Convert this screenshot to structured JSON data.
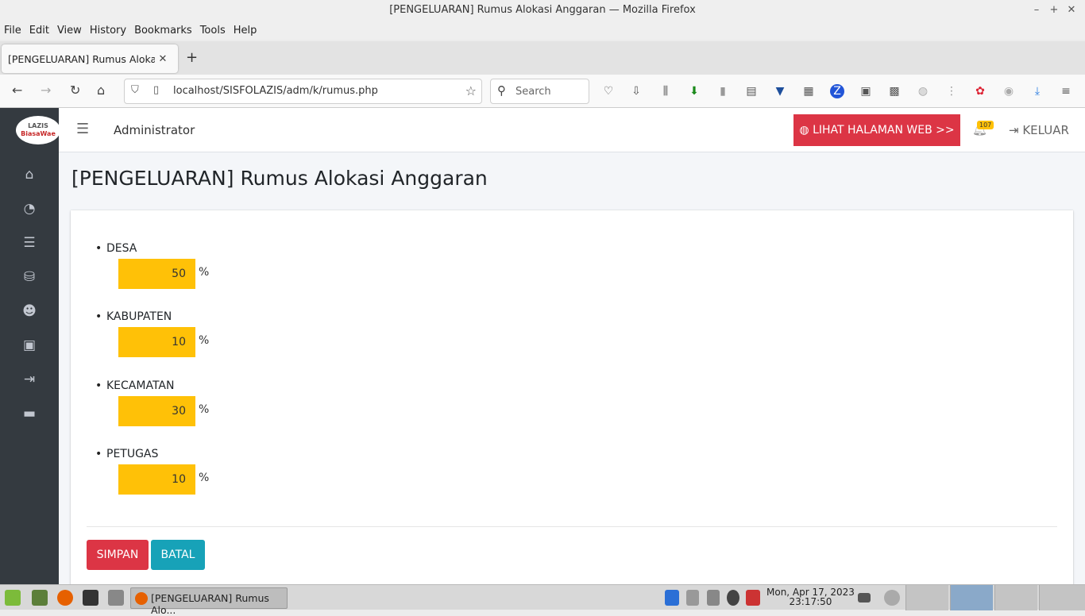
{
  "window": {
    "title": "[PENGELUARAN] Rumus Alokasi Anggaran — Mozilla Firefox"
  },
  "menu": [
    "File",
    "Edit",
    "View",
    "History",
    "Bookmarks",
    "Tools",
    "Help"
  ],
  "tab": {
    "title": "[PENGELUARAN] Rumus Alokasi A"
  },
  "nav": {
    "url": "localhost/SISFOLAZIS/adm/k/rumus.php",
    "search_placeholder": "Search"
  },
  "app": {
    "logo_line1": "LAZIS",
    "logo_line2": "BiasaWae",
    "user": "Administrator",
    "web_button": "LIHAT HALAMAN WEB >>",
    "notif_count": "107",
    "logout": "KELUAR",
    "page_title": "[PENGELUARAN] Rumus Alokasi Anggaran",
    "allocations": [
      {
        "label": "DESA",
        "value": "50",
        "unit": "%"
      },
      {
        "label": "KABUPATEN",
        "value": "10",
        "unit": "%"
      },
      {
        "label": "KECAMATAN",
        "value": "30",
        "unit": "%"
      },
      {
        "label": "PETUGAS",
        "value": "10",
        "unit": "%"
      }
    ],
    "save": "SIMPAN",
    "cancel": "BATAL",
    "colors": {
      "danger": "#dc3545",
      "info": "#17a2b8",
      "warning": "#ffc107",
      "sidebar": "#343a40"
    }
  },
  "taskbar": {
    "window_label": "[PENGELUARAN] Rumus Alo...",
    "clock_date": "Mon, Apr 17, 2023",
    "clock_time": "23:17:50"
  }
}
